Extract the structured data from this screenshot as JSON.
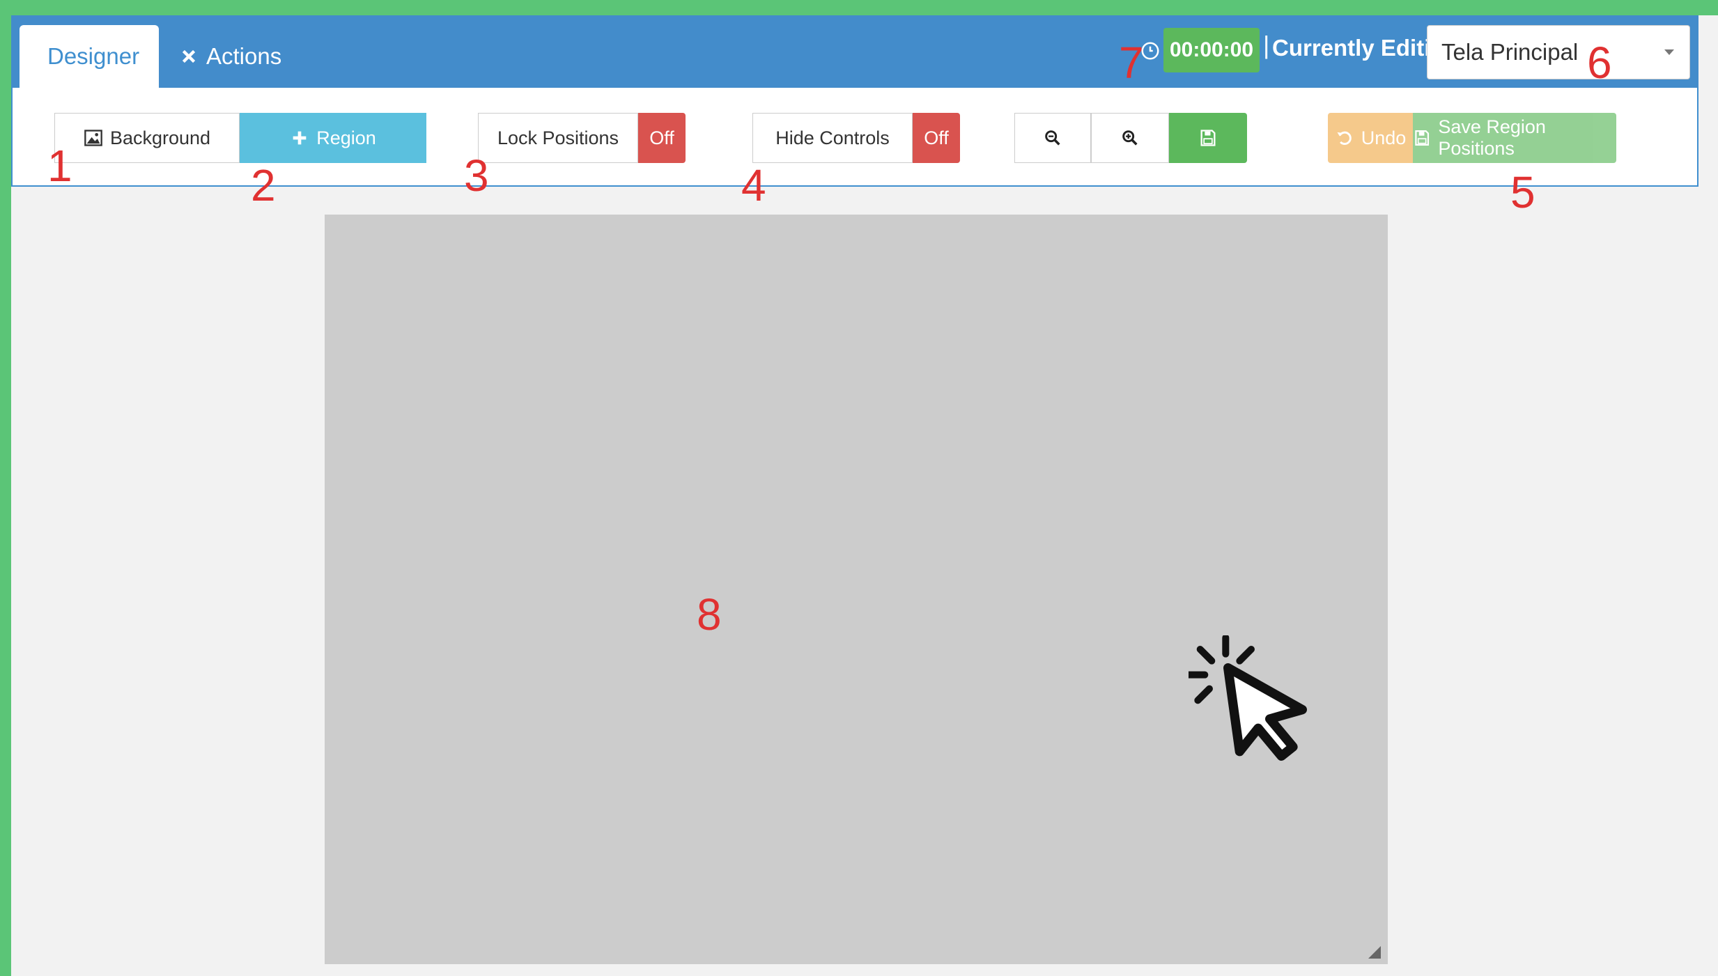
{
  "tabs": {
    "designer": "Designer",
    "actions": "Actions"
  },
  "header": {
    "timer": "00:00:00",
    "separator": "|",
    "editing_label": "Currently Editing",
    "screen_select_value": "Tela Principal"
  },
  "toolbar": {
    "background_label": "Background",
    "region_label": "Region",
    "lock_positions_label": "Lock Positions",
    "lock_positions_state": "Off",
    "hide_controls_label": "Hide Controls",
    "hide_controls_state": "Off",
    "undo_label": "Undo",
    "save_region_label": "Save Region Positions"
  },
  "annotations": {
    "n1": "1",
    "n2": "2",
    "n3": "3",
    "n4": "4",
    "n5": "5",
    "n6": "6",
    "n7": "7",
    "n8": "8"
  },
  "colors": {
    "page_background": "#5bc577",
    "header_blue": "#438ccb",
    "info": "#5bc0de",
    "danger": "#d9534f",
    "success": "#5cb85c",
    "warning": "#f0ad4e",
    "canvas_gray": "#cccccc",
    "annotation_red": "#e03131"
  },
  "icons": {
    "designer": "edit-icon",
    "actions": "close-icon",
    "timer": "clock-icon",
    "background": "image-icon",
    "region": "plus-icon",
    "zoom_out": "zoom-out-icon",
    "zoom_in": "zoom-in-icon",
    "save": "floppy-disk-icon",
    "undo": "undo-icon",
    "save_region": "floppy-disk-icon"
  }
}
